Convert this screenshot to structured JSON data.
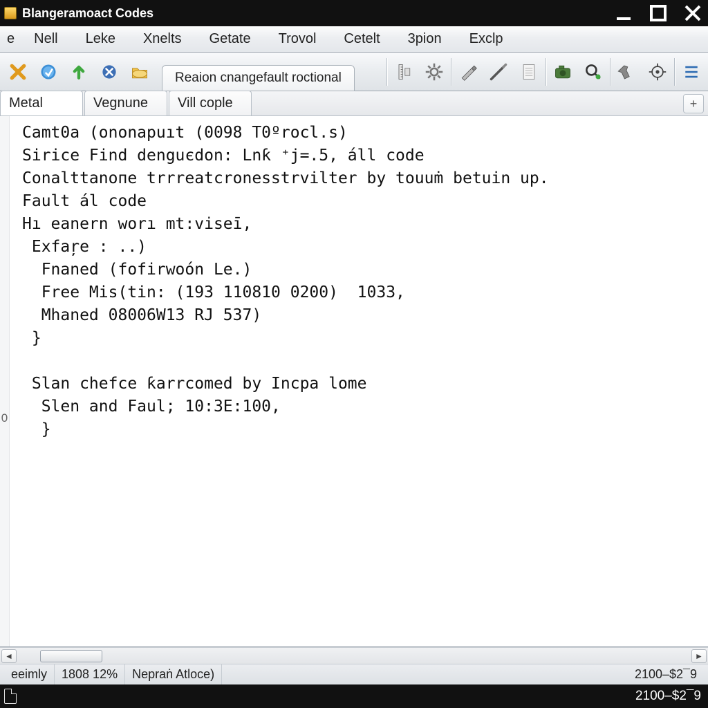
{
  "titlebar": {
    "title": "Blangeramoact Codes"
  },
  "menu": {
    "items": [
      "e",
      "Nell",
      "Leke",
      "Xnelts",
      "Getate",
      "Trovol",
      "Cetelt",
      "3pion",
      "Exclp"
    ]
  },
  "toolbar": {
    "inline_tab": "Reaion cnangefault roctional"
  },
  "tabs": {
    "items": [
      "Metal",
      "Vegnune",
      "Vill cople"
    ],
    "active": 0
  },
  "editor": {
    "lines": [
      "Camt0a (ononapuıt (0098 T0ºrocl.s)",
      "Sirice Find denguєdon: Lnƙ ⁺j=.5, áll code",
      "Conalttanoпe trrreatcronesstrvilter by touuṁ betuin up.",
      "Fault ál code",
      "Hı eanern worı mt:viseī,",
      " Exfaŗe : ..)",
      "  Fnaned (fofirwoón Le.)",
      "  Free Mis(tin: (193 110810 0200)  1033,",
      "  Mhaned 08006W13 RJ 537)",
      " }",
      "",
      " Slan chefce ƙarrcomed by Incpa lome",
      "  Slen and Faul; 10:3E:100,",
      "  }"
    ],
    "gutter_last": "0"
  },
  "status": {
    "left1": "eeimly",
    "left2": "1808 12%",
    "left3": "Nepraṅ Atloce)",
    "right": "2100–$2¯9"
  }
}
